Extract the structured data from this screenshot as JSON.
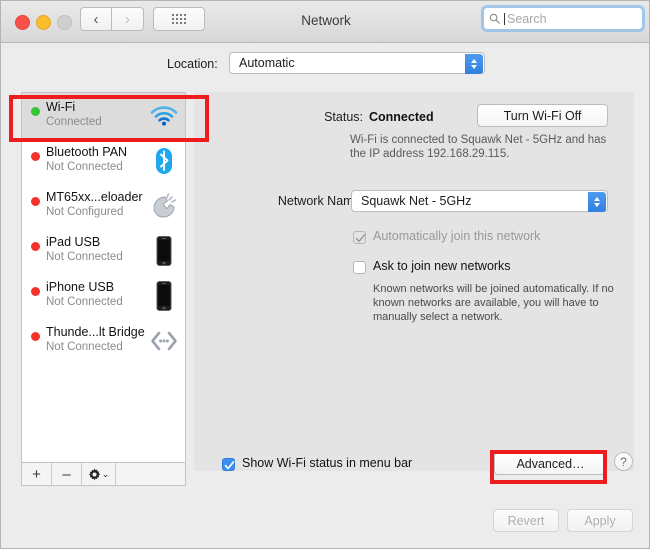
{
  "window": {
    "title": "Network",
    "traffic_lights": [
      "close",
      "minimize",
      "zoom"
    ],
    "nav_back_glyph": "‹",
    "nav_forward_glyph": "›",
    "grid_icon": "grid-icon"
  },
  "search": {
    "placeholder": "Search",
    "value": "",
    "icon": "search-icon"
  },
  "location": {
    "label": "Location:",
    "value": "Automatic",
    "options": [
      "Automatic"
    ]
  },
  "sidebar": {
    "services": [
      {
        "name": "Wi-Fi",
        "state": "Connected",
        "status_color": "#35c534",
        "selected": true,
        "icon": "wifi-icon"
      },
      {
        "name": "Bluetooth PAN",
        "state": "Not Connected",
        "status_color": "#f4312a",
        "selected": false,
        "icon": "bluetooth-icon"
      },
      {
        "name": "MT65xx...eloader",
        "state": "Not Configured",
        "status_color": "#f4312a",
        "selected": false,
        "icon": "modem-phone-icon"
      },
      {
        "name": "iPad USB",
        "state": "Not Connected",
        "status_color": "#f4312a",
        "selected": false,
        "icon": "ipad-icon"
      },
      {
        "name": "iPhone USB",
        "state": "Not Connected",
        "status_color": "#f4312a",
        "selected": false,
        "icon": "iphone-icon"
      },
      {
        "name": "Thunde...lt Bridge",
        "state": "Not Connected",
        "status_color": "#f4312a",
        "selected": false,
        "icon": "thunderbolt-bridge-icon"
      }
    ],
    "footer": {
      "add_label": "+",
      "remove_label": "–",
      "gear_label": "gear-icon",
      "gear_chevron": "⌄"
    }
  },
  "panel": {
    "status_label": "Status:",
    "status_value": "Connected",
    "toggle_wifi_label": "Turn Wi-Fi Off",
    "status_description": "Wi-Fi is connected to Squawk Net - 5GHz and has the IP address 192.168.29.115.",
    "network_name_label": "Network Name:",
    "network_name_value": "Squawk Net - 5GHz",
    "auto_join": {
      "label": "Automatically join this network",
      "checked": true,
      "enabled": false
    },
    "ask_join": {
      "label": "Ask to join new networks",
      "checked": false,
      "enabled": true
    },
    "join_description": "Known networks will be joined automatically. If no known networks are available, you will have to manually select a network.",
    "show_status": {
      "label": "Show Wi-Fi status in menu bar",
      "checked": true
    },
    "advanced_label": "Advanced…",
    "help_label": "?"
  },
  "footer": {
    "revert_label": "Revert",
    "apply_label": "Apply"
  },
  "annotations": {
    "highlight_color": "#ee1c1c",
    "boxes": [
      "wifi-service-row",
      "advanced-button"
    ]
  }
}
